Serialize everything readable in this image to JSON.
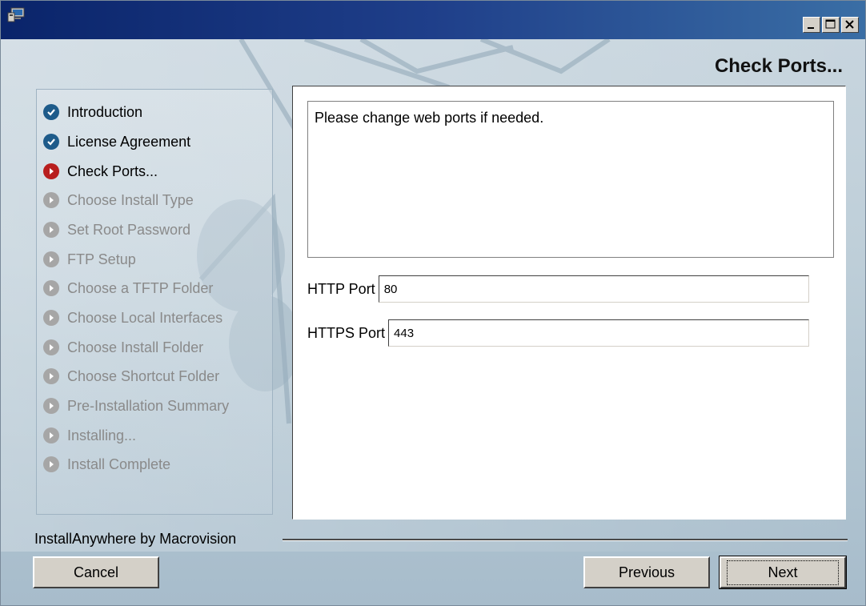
{
  "window": {
    "icon": "installer-computer-icon",
    "controls": [
      "minimize-icon",
      "maximize-icon",
      "close-icon"
    ]
  },
  "header": {
    "title": "Check Ports..."
  },
  "steps": [
    {
      "label": "Introduction",
      "state": "done"
    },
    {
      "label": "License Agreement",
      "state": "done"
    },
    {
      "label": "Check Ports...",
      "state": "current"
    },
    {
      "label": "Choose Install Type",
      "state": "pending"
    },
    {
      "label": "Set Root Password",
      "state": "pending"
    },
    {
      "label": "FTP Setup",
      "state": "pending"
    },
    {
      "label": "Choose a TFTP Folder",
      "state": "pending"
    },
    {
      "label": "Choose Local Interfaces",
      "state": "pending"
    },
    {
      "label": "Choose Install Folder",
      "state": "pending"
    },
    {
      "label": "Choose Shortcut Folder",
      "state": "pending"
    },
    {
      "label": "Pre-Installation Summary",
      "state": "pending"
    },
    {
      "label": "Installing...",
      "state": "pending"
    },
    {
      "label": "Install Complete",
      "state": "pending"
    }
  ],
  "content": {
    "message": "Please change web ports if needed.",
    "http_port": {
      "label": "HTTP Port",
      "value": "80"
    },
    "https_port": {
      "label": "HTTPS Port",
      "value": "443"
    }
  },
  "footer": {
    "brand": "InstallAnywhere by Macrovision",
    "cancel_label": "Cancel",
    "previous_label": "Previous",
    "next_label": "Next"
  },
  "colors": {
    "title_bar": "#0a246a",
    "step_done": "#1e5b8a",
    "step_current": "#b81e1e",
    "step_pending": "#a6a6a6"
  }
}
